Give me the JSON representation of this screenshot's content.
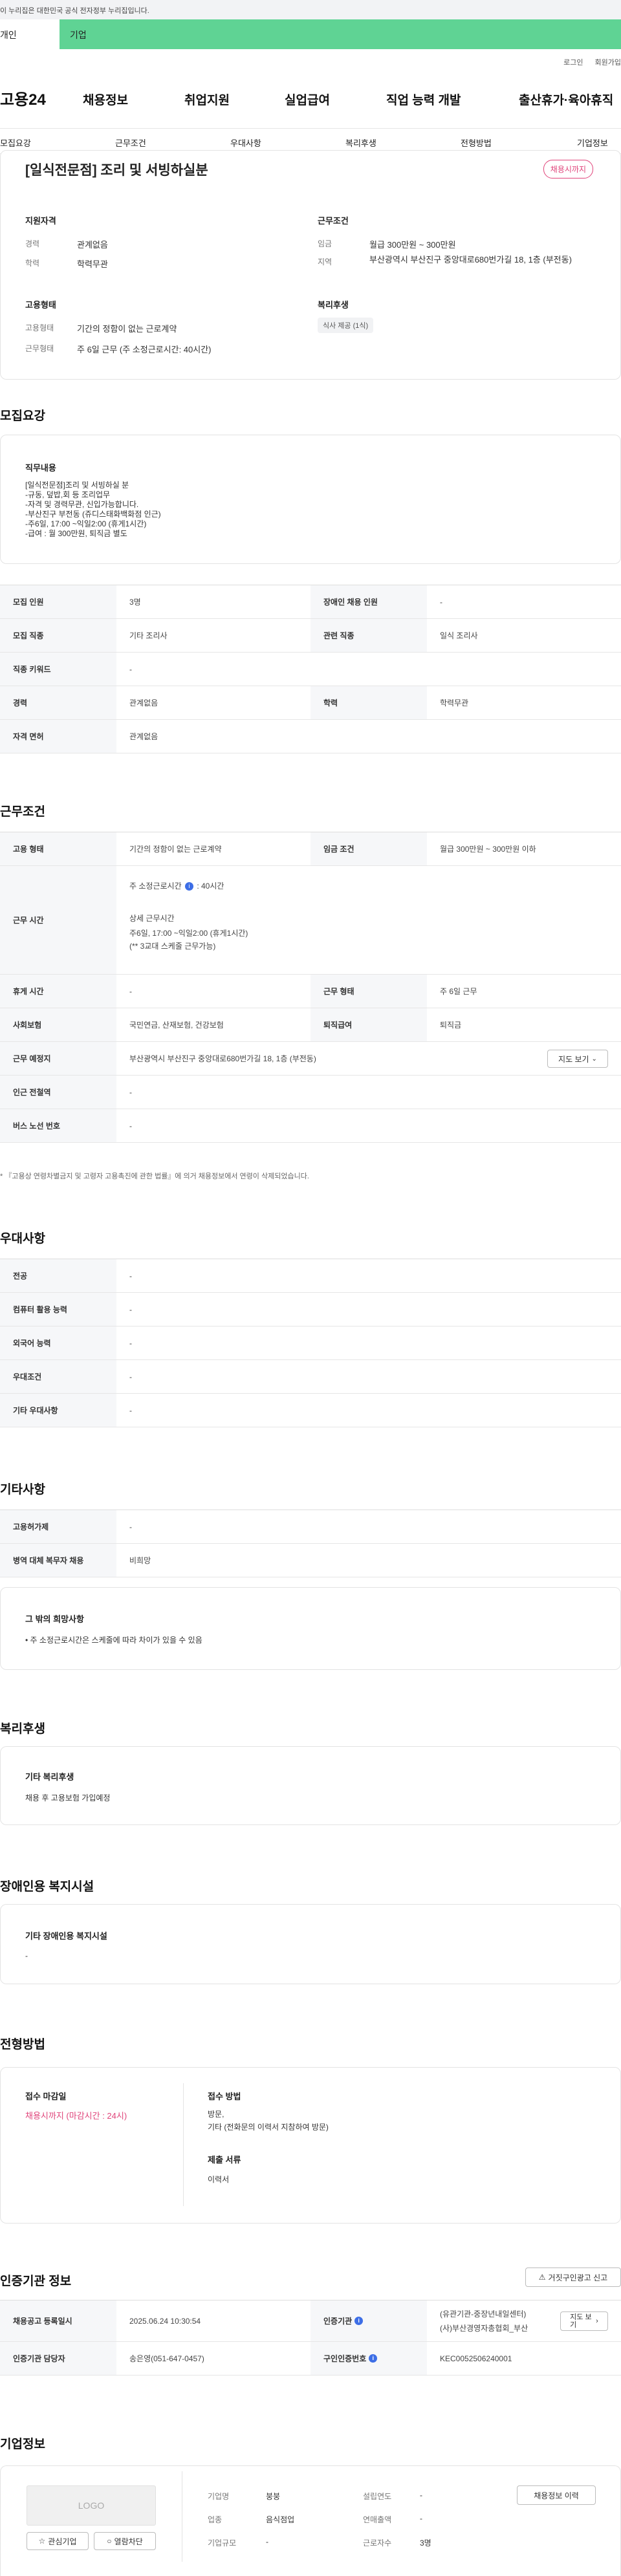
{
  "gov_banner": "이 누리집은 대한민국 공식 전자정부 누리집입니다.",
  "top_tabs": {
    "individual": "개인",
    "corporate": "기업"
  },
  "util_links": [
    "로그인",
    "회원가입"
  ],
  "logo": "고용24",
  "gnb": [
    "채용정보",
    "취업지원",
    "실업급여",
    "직업 능력 개발",
    "출산휴가·육아휴직"
  ],
  "subnav": [
    "모집요강",
    "근무조건",
    "우대사항",
    "복리후생",
    "전형방법",
    "기업정보"
  ],
  "summary": {
    "title": "[일식전문점] 조리 및 서빙하실분",
    "badge": "채용시까지",
    "qual_head": "지원자격",
    "career_l": "경력",
    "career_v": "관계없음",
    "edu_l": "학력",
    "edu_v": "학력무관",
    "emp_head": "고용형태",
    "emptype_l": "고용형태",
    "emptype_v": "기간의 정함이 없는 근로계약",
    "worktype_l": "근무형태",
    "worktype_v": "주 6일 근무 (주 소정근로시간: 40시간)",
    "cond_head": "근무조건",
    "wage_l": "임금",
    "wage_v": "월급 300만원 ~ 300만원",
    "region_l": "지역",
    "region_v": "부산광역시 부산진구 중앙대로680번가길 18, 1층 (부전동)",
    "welfare_head": "복리후생",
    "welfare_tag": "식사 제공 (1식)"
  },
  "recruit": {
    "section": "모집요강",
    "duty_head": "직무내용",
    "duty_text": "[일식전문점]조리 및 서빙하실 분\n-규동, 덮밥,회 등 조리업무\n-자격 및 경력무관, 신입가능합니다.\n-부산진구 부전동 (쥬디스태화백화점 인근)\n-주6일, 17:00 ~익일2:00 (휴게1시간)\n-급여 : 월 300만원, 퇴직금 별도",
    "rows": [
      {
        "l1": "모집 인원",
        "v1": "3명",
        "l2": "장애인 채용 인원",
        "v2": "-"
      },
      {
        "l1": "모집 직종",
        "v1": "기타 조리사",
        "l2": "관련 직종",
        "v2": "일식 조리사"
      },
      {
        "l1": "직종 키워드",
        "v1": "-",
        "l2": "",
        "v2": ""
      },
      {
        "l1": "경력",
        "v1": "관계없음",
        "l2": "학력",
        "v2": "학력무관"
      },
      {
        "l1": "자격 면허",
        "v1": "관계없음",
        "l2": "",
        "v2": ""
      }
    ]
  },
  "work": {
    "section": "근무조건",
    "emp_l": "고용 형태",
    "emp_v": "기간의 정함이 없는 근로계약",
    "wage_l": "임금 조건",
    "wage_v": "월급 300만원 ~ 300만원 이하",
    "hours_l": "근무 시간",
    "hours_top": "주 소정근로시간",
    "hours_top_v": ": 40시간",
    "hours_detail_head": "상세 근무시간",
    "hours_detail": "주6일, 17:00 ~익일2:00 (휴게1시간)\n(** 3교대 스케줄 근무가능)",
    "rest_l": "휴게 시간",
    "rest_v": "-",
    "wtype_l": "근무 형태",
    "wtype_v": "주 6일 근무",
    "ins_l": "사회보험",
    "ins_v": "국민연금, 산재보험, 건강보험",
    "ret_l": "퇴직급여",
    "ret_v": "퇴직금",
    "place_l": "근무 예정지",
    "place_v": "부산광역시 부산진구 중앙대로680번가길 18, 1층 (부전동)",
    "map_btn": "지도 보기",
    "station_l": "인근 전철역",
    "station_v": "-",
    "bus_l": "버스 노선 번호",
    "bus_v": "-",
    "note": "* 『고용상 연령차별금지 및 고령자 고용촉진에 관한 법률』에 의거 채용정보에서 연령이 삭제되었습니다."
  },
  "pref": {
    "section": "우대사항",
    "rows": [
      {
        "l": "전공",
        "v": "-"
      },
      {
        "l": "컴퓨터 활용 능력",
        "v": "-"
      },
      {
        "l": "외국어 능력",
        "v": "-"
      },
      {
        "l": "우대조건",
        "v": "-"
      },
      {
        "l": "기타 우대사항",
        "v": "-"
      }
    ]
  },
  "etc": {
    "section": "기타사항",
    "rows": [
      {
        "l": "고용허가제",
        "v": "-"
      },
      {
        "l": "병역 대체 복무자 채용",
        "v": "비희망"
      }
    ],
    "box_head": "그 밖의 희망사항",
    "box_item": "주 소정근로시간은 스케줄에 따라 차이가 있을 수 있음"
  },
  "welfare": {
    "section": "복리후생",
    "head": "기타 복리후생",
    "text": "채용 후 고용보험 가입예정"
  },
  "disability": {
    "section": "장애인용 복지시설",
    "head": "기타 장애인용 복지시설",
    "text": "-"
  },
  "process": {
    "section": "전형방법",
    "deadline_head": "접수 마감일",
    "deadline_v": "채용시까지 (마감시간 : 24시)",
    "method_head": "접수 방법",
    "method_v": "방문,\n기타 (전화문의 이력서 지참하여  방문)",
    "docs_head": "제출 서류",
    "docs_v": "이력서"
  },
  "cert": {
    "section": "인증기관 정보",
    "report_btn": "거짓구인광고 신고",
    "reg_l": "채용공고 등록일시",
    "reg_v": "2025.06.24 10:30:54",
    "org_l": "인증기관",
    "org_v": "(유관기관-중장년내일센터)\n(사)부산경영자총협회_부산",
    "map_btn": "지도 보기",
    "mgr_l": "인증기관 담당자",
    "mgr_v": "송은영(051-647-0457)",
    "cert_l": "구인인증번호",
    "cert_v": "KEC0052506240001"
  },
  "company": {
    "section": "기업정보",
    "logo": "LOGO",
    "fav_btn": "관심기업",
    "block_btn": "열람차단",
    "name_l": "기업명",
    "name_v": "붕붕",
    "ind_l": "업종",
    "ind_v": "음식점업",
    "size_l": "기업규모",
    "size_v": "-",
    "est_l": "설립연도",
    "est_v": "-",
    "sales_l": "연매출액",
    "sales_v": "-",
    "emp_l": "근로자수",
    "emp_v": "3명",
    "history_btn": "채용정보 이력"
  }
}
